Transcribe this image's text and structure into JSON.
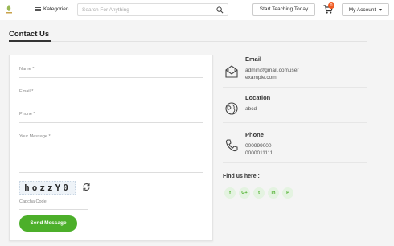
{
  "header": {
    "categories_label": "Kategorien",
    "search_placeholder": "Search For Anything",
    "teach_label": "Start Teaching Today",
    "cart_count": "0",
    "account_label": "My Account"
  },
  "page": {
    "title": "Contact Us"
  },
  "form": {
    "name_placeholder": "Name *",
    "email_placeholder": "Email *",
    "phone_placeholder": "Phone *",
    "message_placeholder": "Your Message *",
    "captcha_text": "hozzY0",
    "captcha_placeholder": "Capcha Code",
    "send_label": "Send Message"
  },
  "contact": {
    "email": {
      "heading": "Email",
      "line1": "admin@gmail.comuser",
      "line2": "example.com"
    },
    "location": {
      "heading": "Location",
      "line1": "abcd"
    },
    "phone": {
      "heading": "Phone",
      "line1": "000999000",
      "line2": "0000011111"
    },
    "find_us": "Find us here :",
    "social": [
      "f",
      "G+",
      "t",
      "in",
      "P"
    ]
  },
  "colors": {
    "accent_green": "#4caf2a",
    "badge_orange": "#f05a22"
  }
}
